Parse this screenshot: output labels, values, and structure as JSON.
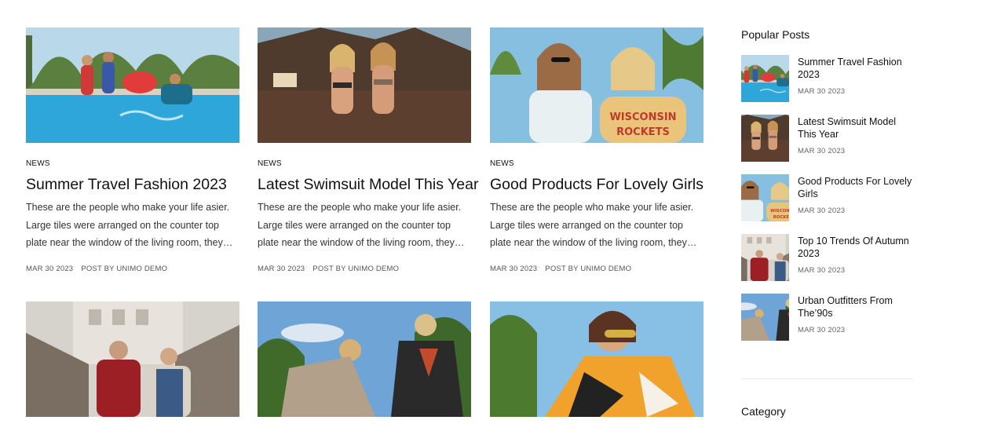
{
  "posts": [
    {
      "category": "NEWS",
      "title": "Summer Travel Fashion 2023",
      "excerpt": "These are the people who make your life asier. Large tiles were arranged on the counter top plate near the window of the living room, they…",
      "date": "MAR 30 2023",
      "author": "POST BY UNIMO DEMO",
      "image": "pool-party-photo"
    },
    {
      "category": "NEWS",
      "title": "Latest Swimsuit Model This Year",
      "excerpt": "These are the people who make your life asier. Large tiles were arranged on the counter top plate near the window of the living room, they…",
      "date": "MAR 30 2023",
      "author": "POST BY UNIMO DEMO",
      "image": "beach-models-photo"
    },
    {
      "category": "NEWS",
      "title": "Good Products For Lovely Girls",
      "excerpt": "These are the people who make your life asier. Large tiles were arranged on the counter top plate near the window of the living room, they…",
      "date": "MAR 30 2023",
      "author": "POST BY UNIMO DEMO",
      "image": "two-girls-sweatshirts-photo"
    },
    {
      "image": "urban-men-photo"
    },
    {
      "image": "scarf-women-photo"
    },
    {
      "image": "patterned-jacket-photo"
    }
  ],
  "sidebar": {
    "popular_heading": "Popular Posts",
    "popular": [
      {
        "title": "Summer Travel Fashion 2023",
        "date": "MAR 30 2023"
      },
      {
        "title": "Latest Swimsuit Model This Year",
        "date": "MAR 30 2023"
      },
      {
        "title": "Good Products For Lovely Girls",
        "date": "MAR 30 2023"
      },
      {
        "title": "Top 10 Trends Of Autumn 2023",
        "date": "MAR 30 2023"
      },
      {
        "title": "Urban Outfitters From The’90s",
        "date": "MAR 30 2023"
      }
    ],
    "category_heading": "Category"
  }
}
